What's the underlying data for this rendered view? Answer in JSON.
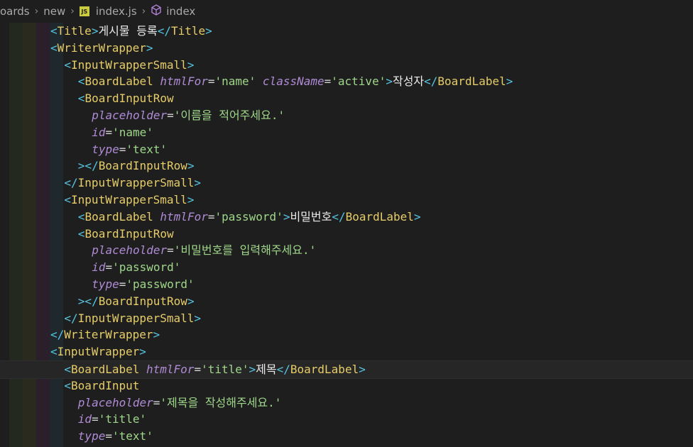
{
  "breadcrumb": {
    "items": [
      "oards",
      "new",
      "index.js",
      "index"
    ],
    "file_icon_text": "JS"
  },
  "code": {
    "lines": [
      {
        "indent": 0,
        "tokens": [
          [
            "tag",
            "<"
          ],
          [
            "comp",
            "Title"
          ],
          [
            "tag",
            ">"
          ],
          [
            "kr",
            "게시물 등록"
          ],
          [
            "tag",
            "</"
          ],
          [
            "comp",
            "Title"
          ],
          [
            "tag",
            ">"
          ]
        ]
      },
      {
        "indent": 0,
        "tokens": [
          [
            "tag",
            "<"
          ],
          [
            "comp",
            "WriterWrapper"
          ],
          [
            "tag",
            ">"
          ]
        ]
      },
      {
        "indent": 1,
        "tokens": [
          [
            "tag",
            "<"
          ],
          [
            "comp",
            "InputWrapperSmall"
          ],
          [
            "tag",
            ">"
          ]
        ]
      },
      {
        "indent": 2,
        "tokens": [
          [
            "tag",
            "<"
          ],
          [
            "comp",
            "BoardLabel"
          ],
          [
            "eq",
            " "
          ],
          [
            "attr",
            "htmlFor"
          ],
          [
            "eq",
            "="
          ],
          [
            "str",
            "'name'"
          ],
          [
            "eq",
            " "
          ],
          [
            "attr",
            "className"
          ],
          [
            "eq",
            "="
          ],
          [
            "str",
            "'active'"
          ],
          [
            "tag",
            ">"
          ],
          [
            "kr",
            "작성자"
          ],
          [
            "tag",
            "</"
          ],
          [
            "comp",
            "BoardLabel"
          ],
          [
            "tag",
            ">"
          ]
        ]
      },
      {
        "indent": 2,
        "tokens": [
          [
            "tag",
            "<"
          ],
          [
            "comp",
            "BoardInputRow"
          ]
        ]
      },
      {
        "indent": 3,
        "tokens": [
          [
            "attr",
            "placeholder"
          ],
          [
            "eq",
            "="
          ],
          [
            "str",
            "'이름을 적어주세요.'"
          ]
        ]
      },
      {
        "indent": 3,
        "tokens": [
          [
            "attr",
            "id"
          ],
          [
            "eq",
            "="
          ],
          [
            "str",
            "'name'"
          ]
        ]
      },
      {
        "indent": 3,
        "tokens": [
          [
            "attr",
            "type"
          ],
          [
            "eq",
            "="
          ],
          [
            "str",
            "'text'"
          ]
        ]
      },
      {
        "indent": 2,
        "tokens": [
          [
            "tag",
            "></"
          ],
          [
            "comp",
            "BoardInputRow"
          ],
          [
            "tag",
            ">"
          ]
        ]
      },
      {
        "indent": 1,
        "tokens": [
          [
            "tag",
            "</"
          ],
          [
            "comp",
            "InputWrapperSmall"
          ],
          [
            "tag",
            ">"
          ]
        ]
      },
      {
        "indent": 1,
        "tokens": [
          [
            "tag",
            "<"
          ],
          [
            "comp",
            "InputWrapperSmall"
          ],
          [
            "tag",
            ">"
          ]
        ]
      },
      {
        "indent": 2,
        "tokens": [
          [
            "tag",
            "<"
          ],
          [
            "comp",
            "BoardLabel"
          ],
          [
            "eq",
            " "
          ],
          [
            "attr",
            "htmlFor"
          ],
          [
            "eq",
            "="
          ],
          [
            "str",
            "'password'"
          ],
          [
            "tag",
            ">"
          ],
          [
            "kr",
            "비밀번호"
          ],
          [
            "tag",
            "</"
          ],
          [
            "comp",
            "BoardLabel"
          ],
          [
            "tag",
            ">"
          ]
        ]
      },
      {
        "indent": 2,
        "tokens": [
          [
            "tag",
            "<"
          ],
          [
            "comp",
            "BoardInputRow"
          ]
        ]
      },
      {
        "indent": 3,
        "tokens": [
          [
            "attr",
            "placeholder"
          ],
          [
            "eq",
            "="
          ],
          [
            "str",
            "'비밀번호를 입력해주세요.'"
          ]
        ]
      },
      {
        "indent": 3,
        "tokens": [
          [
            "attr",
            "id"
          ],
          [
            "eq",
            "="
          ],
          [
            "str",
            "'password'"
          ]
        ]
      },
      {
        "indent": 3,
        "tokens": [
          [
            "attr",
            "type"
          ],
          [
            "eq",
            "="
          ],
          [
            "str",
            "'password'"
          ]
        ]
      },
      {
        "indent": 2,
        "tokens": [
          [
            "tag",
            "></"
          ],
          [
            "comp",
            "BoardInputRow"
          ],
          [
            "tag",
            ">"
          ]
        ]
      },
      {
        "indent": 1,
        "tokens": [
          [
            "tag",
            "</"
          ],
          [
            "comp",
            "InputWrapperSmall"
          ],
          [
            "tag",
            ">"
          ]
        ]
      },
      {
        "indent": 0,
        "tokens": [
          [
            "tag",
            "</"
          ],
          [
            "comp",
            "WriterWrapper"
          ],
          [
            "tag",
            ">"
          ]
        ]
      },
      {
        "indent": 0,
        "tokens": [
          [
            "tag",
            "<"
          ],
          [
            "comp",
            "InputWrapper"
          ],
          [
            "tag",
            ">"
          ]
        ]
      },
      {
        "indent": 1,
        "current": true,
        "tokens": [
          [
            "tag",
            "<"
          ],
          [
            "comp",
            "BoardLabel"
          ],
          [
            "eq",
            " "
          ],
          [
            "attr",
            "htmlFor"
          ],
          [
            "eq",
            "="
          ],
          [
            "str",
            "'title'"
          ],
          [
            "tag",
            ">"
          ],
          [
            "kr",
            "제목"
          ],
          [
            "tag",
            "</"
          ],
          [
            "comp",
            "BoardLabel"
          ],
          [
            "tag",
            ">"
          ]
        ]
      },
      {
        "indent": 1,
        "tokens": [
          [
            "tag",
            "<"
          ],
          [
            "comp",
            "BoardInput"
          ]
        ]
      },
      {
        "indent": 2,
        "tokens": [
          [
            "attr",
            "placeholder"
          ],
          [
            "eq",
            "="
          ],
          [
            "str",
            "'제목을 작성해주세요.'"
          ]
        ]
      },
      {
        "indent": 2,
        "tokens": [
          [
            "attr",
            "id"
          ],
          [
            "eq",
            "="
          ],
          [
            "str",
            "'title'"
          ]
        ]
      },
      {
        "indent": 2,
        "tokens": [
          [
            "attr",
            "type"
          ],
          [
            "eq",
            "="
          ],
          [
            "str",
            "'text'"
          ]
        ]
      }
    ]
  },
  "colors": {
    "background": "#1e1e1e",
    "tag": "#56c4e0",
    "component": "#e6cd69",
    "attribute": "#b08bd6",
    "string": "#9fd78a",
    "indent_guides": [
      "#23291f",
      "#2b2a1f",
      "#2b1f2b",
      "#1f282d",
      "#26262a"
    ]
  }
}
